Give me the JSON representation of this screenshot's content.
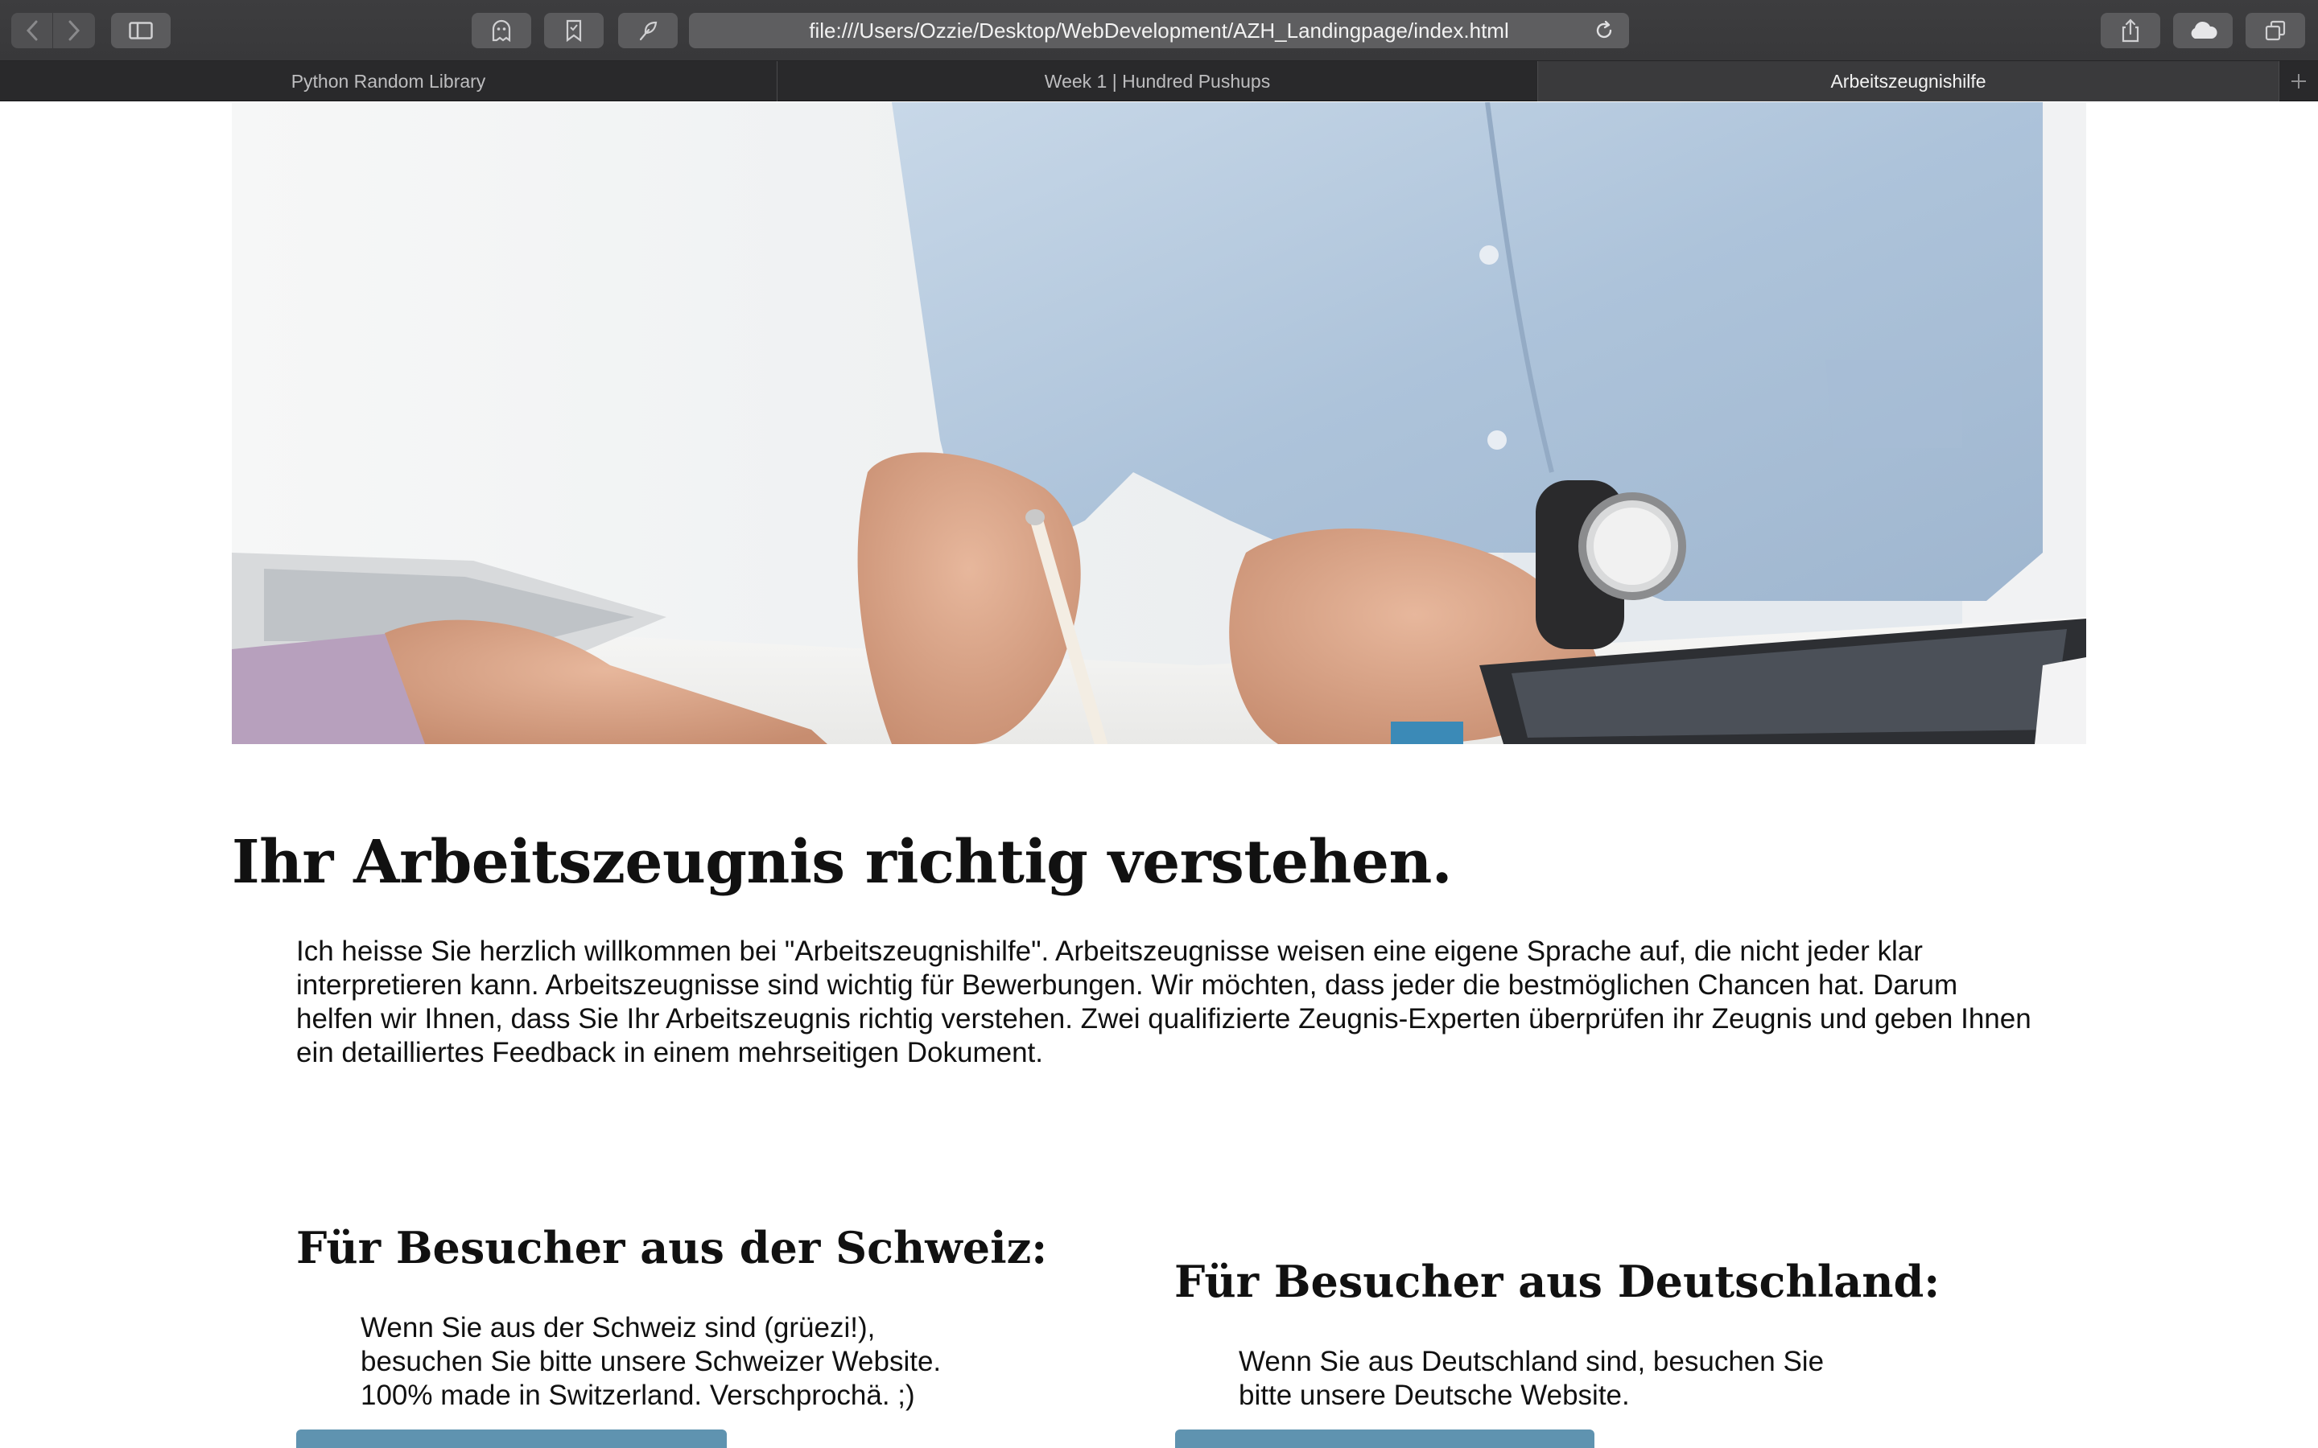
{
  "browser": {
    "url": "file:///Users/Ozzie/Desktop/WebDevelopment/AZH_Landingpage/index.html",
    "tabs": [
      {
        "label": "Python Random Library",
        "active": false
      },
      {
        "label": "Week 1 | Hundred Pushups",
        "active": false
      },
      {
        "label": "Arbeitszeugnishilfe",
        "active": true
      }
    ],
    "icons": [
      "back-icon",
      "forward-icon",
      "sidebar-icon",
      "ghost-extension-icon",
      "bookmark-extension-icon",
      "feather-extension-icon",
      "reload-icon",
      "share-icon",
      "cloud-icon",
      "tabs-overview-icon",
      "new-tab-icon"
    ]
  },
  "hero": {
    "colors": {
      "sky": "#e9eef3",
      "shirt": "#b9cce0",
      "desk": "#f5f5f4",
      "skin": "#d9a58a"
    }
  },
  "main": {
    "title": "Ihr Arbeitszeugnis richtig verstehen.",
    "intro": "Ich heisse Sie herzlich willkommen bei \"Arbeitszeugnishilfe\". Arbeitszeugnisse weisen eine eigene Sprache auf, die nicht jeder klar interpretieren kann. Arbeitszeugnisse sind wichtig für Bewerbungen. Wir möchten, dass jeder die bestmöglichen Chancen hat. Darum helfen wir Ihnen, dass Sie Ihr Arbeitszeugnis richtig verstehen. Zwei qualifizierte Zeugnis-Experten überprüfen ihr Zeugnis und geben Ihnen ein detailliertes Feedback in einem mehrseitigen Dokument."
  },
  "switzerland": {
    "title": "Für Besucher aus der Schweiz:",
    "lines": [
      "Wenn Sie aus der Schweiz sind (grüezi!),",
      "besuchen Sie bitte unsere Schweizer Website.",
      "100% made in Switzerland. Verschprochä. ;)"
    ]
  },
  "germany": {
    "title": "Für Besucher aus Deutschland:",
    "lines": [
      "Wenn Sie aus Deutschland sind, besuchen Sie",
      "bitte unsere Deutsche Website."
    ]
  },
  "colors": {
    "button": "#5f93b0",
    "chrome": "#3a3a3c"
  }
}
